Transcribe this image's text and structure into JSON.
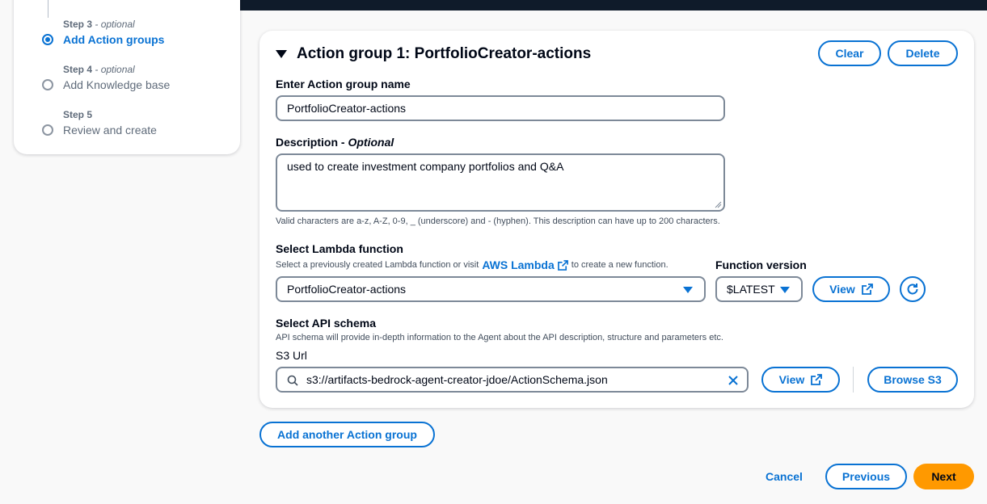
{
  "steps": [
    {
      "label": "Step 3",
      "optional": "- optional",
      "title": "Add Action groups",
      "active": true
    },
    {
      "label": "Step 4",
      "optional": "- optional",
      "title": "Add Knowledge base",
      "active": false
    },
    {
      "label": "Step 5",
      "optional": "",
      "title": "Review and create",
      "active": false
    }
  ],
  "action_group": {
    "title": "Action group 1: PortfolioCreator-actions",
    "clear_label": "Clear",
    "delete_label": "Delete",
    "name_label": "Enter Action group name",
    "name_value": "PortfolioCreator-actions",
    "description_label": "Description - ",
    "description_optional": "Optional",
    "description_value": "used to create investment company portfolios and Q&A",
    "description_hint": "Valid characters are a-z, A-Z, 0-9, _ (underscore) and - (hyphen). This description can have up to 200 characters.",
    "lambda_label": "Select Lambda function",
    "lambda_hint_pre": "Select a previously created Lambda function or visit",
    "lambda_hint_link": "AWS Lambda",
    "lambda_hint_post": "to create a new function.",
    "lambda_value": "PortfolioCreator-actions",
    "function_version_label": "Function version",
    "function_version_value": "$LATEST",
    "view_label": "View",
    "api_schema_label": "Select API schema",
    "api_schema_hint": "API schema will provide in-depth information to the Agent about the API description, structure and parameters etc.",
    "s3_url_label": "S3 Url",
    "s3_url_value": "s3://artifacts-bedrock-agent-creator-jdoe/ActionSchema.json",
    "view2_label": "View",
    "browse_s3_label": "Browse S3"
  },
  "add_another_label": "Add another Action group",
  "footer": {
    "cancel_label": "Cancel",
    "previous_label": "Previous",
    "next_label": "Next"
  },
  "colors": {
    "accent": "#0972d3",
    "primary_button": "#ff9900",
    "header": "#0f1b2a"
  }
}
